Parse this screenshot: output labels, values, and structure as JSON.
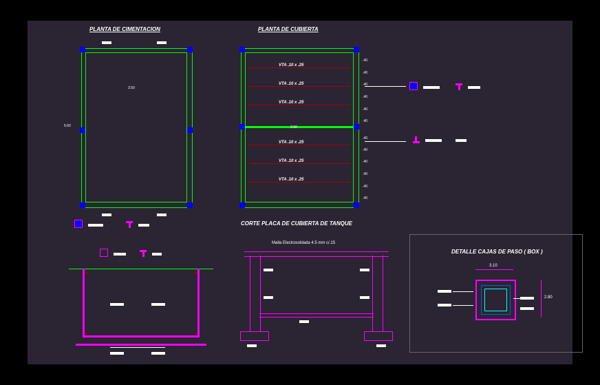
{
  "titles": {
    "foundation": "PLANTA DE CIMENTACION",
    "cover": "PLANTA DE CUBIERTA",
    "tank_cut": "CORTE PLACA DE CUBIERTA DE TANQUE",
    "box_detail": "DETALLE CAJAS DE PASO ( BOX )"
  },
  "foundation": {
    "width_label": "3.50",
    "height_label": "5.60"
  },
  "cover": {
    "width_label": "3.50",
    "beams": [
      "VTA .10 x .25",
      "VTA .10 x .25",
      "VTA .10 x .25",
      "VTA .10 x .25",
      "VTA .10 x .25",
      "VTA .10 x .25"
    ],
    "spacings": [
      ".40",
      ".40",
      ".40",
      ".40",
      ".40",
      ".40",
      ".40",
      ".40",
      ".40",
      ".40",
      ".40",
      ".40"
    ]
  },
  "legends": {
    "column_label": "Columna .15x.15",
    "vigueta_label": "Vigueta VTA"
  },
  "tank_cut": {
    "mesh_label": "Malla Electrosoldada 4.5 mm c/.15"
  },
  "box": {
    "dim_w": "3.10",
    "dim_h": "2.80"
  }
}
